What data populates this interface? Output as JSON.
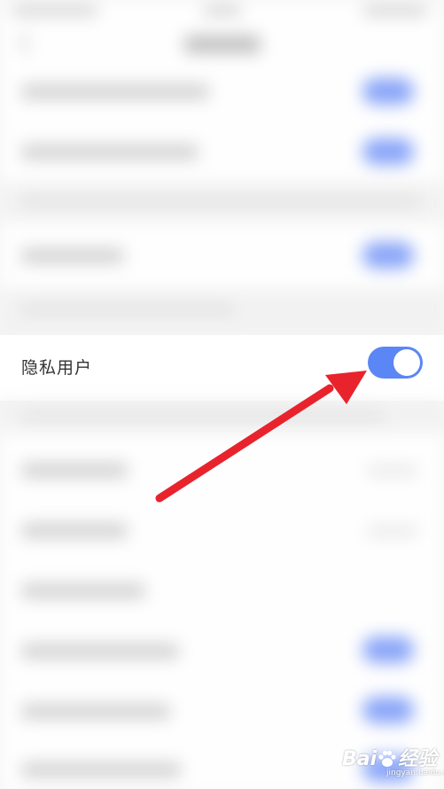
{
  "privacy_row": {
    "label": "隐私用户",
    "toggle_on": true
  },
  "colors": {
    "toggle_on": "#5b86f5",
    "arrow": "#e8232c",
    "label": "#333333"
  },
  "watermark": {
    "brand_prefix": "Bai",
    "brand_suffix": "经验",
    "url": "jingyan.baidu.com"
  },
  "icons": {
    "back": "chevron-left-icon",
    "annotation": "red-arrow-icon",
    "brand": "baidu-paw-icon"
  }
}
